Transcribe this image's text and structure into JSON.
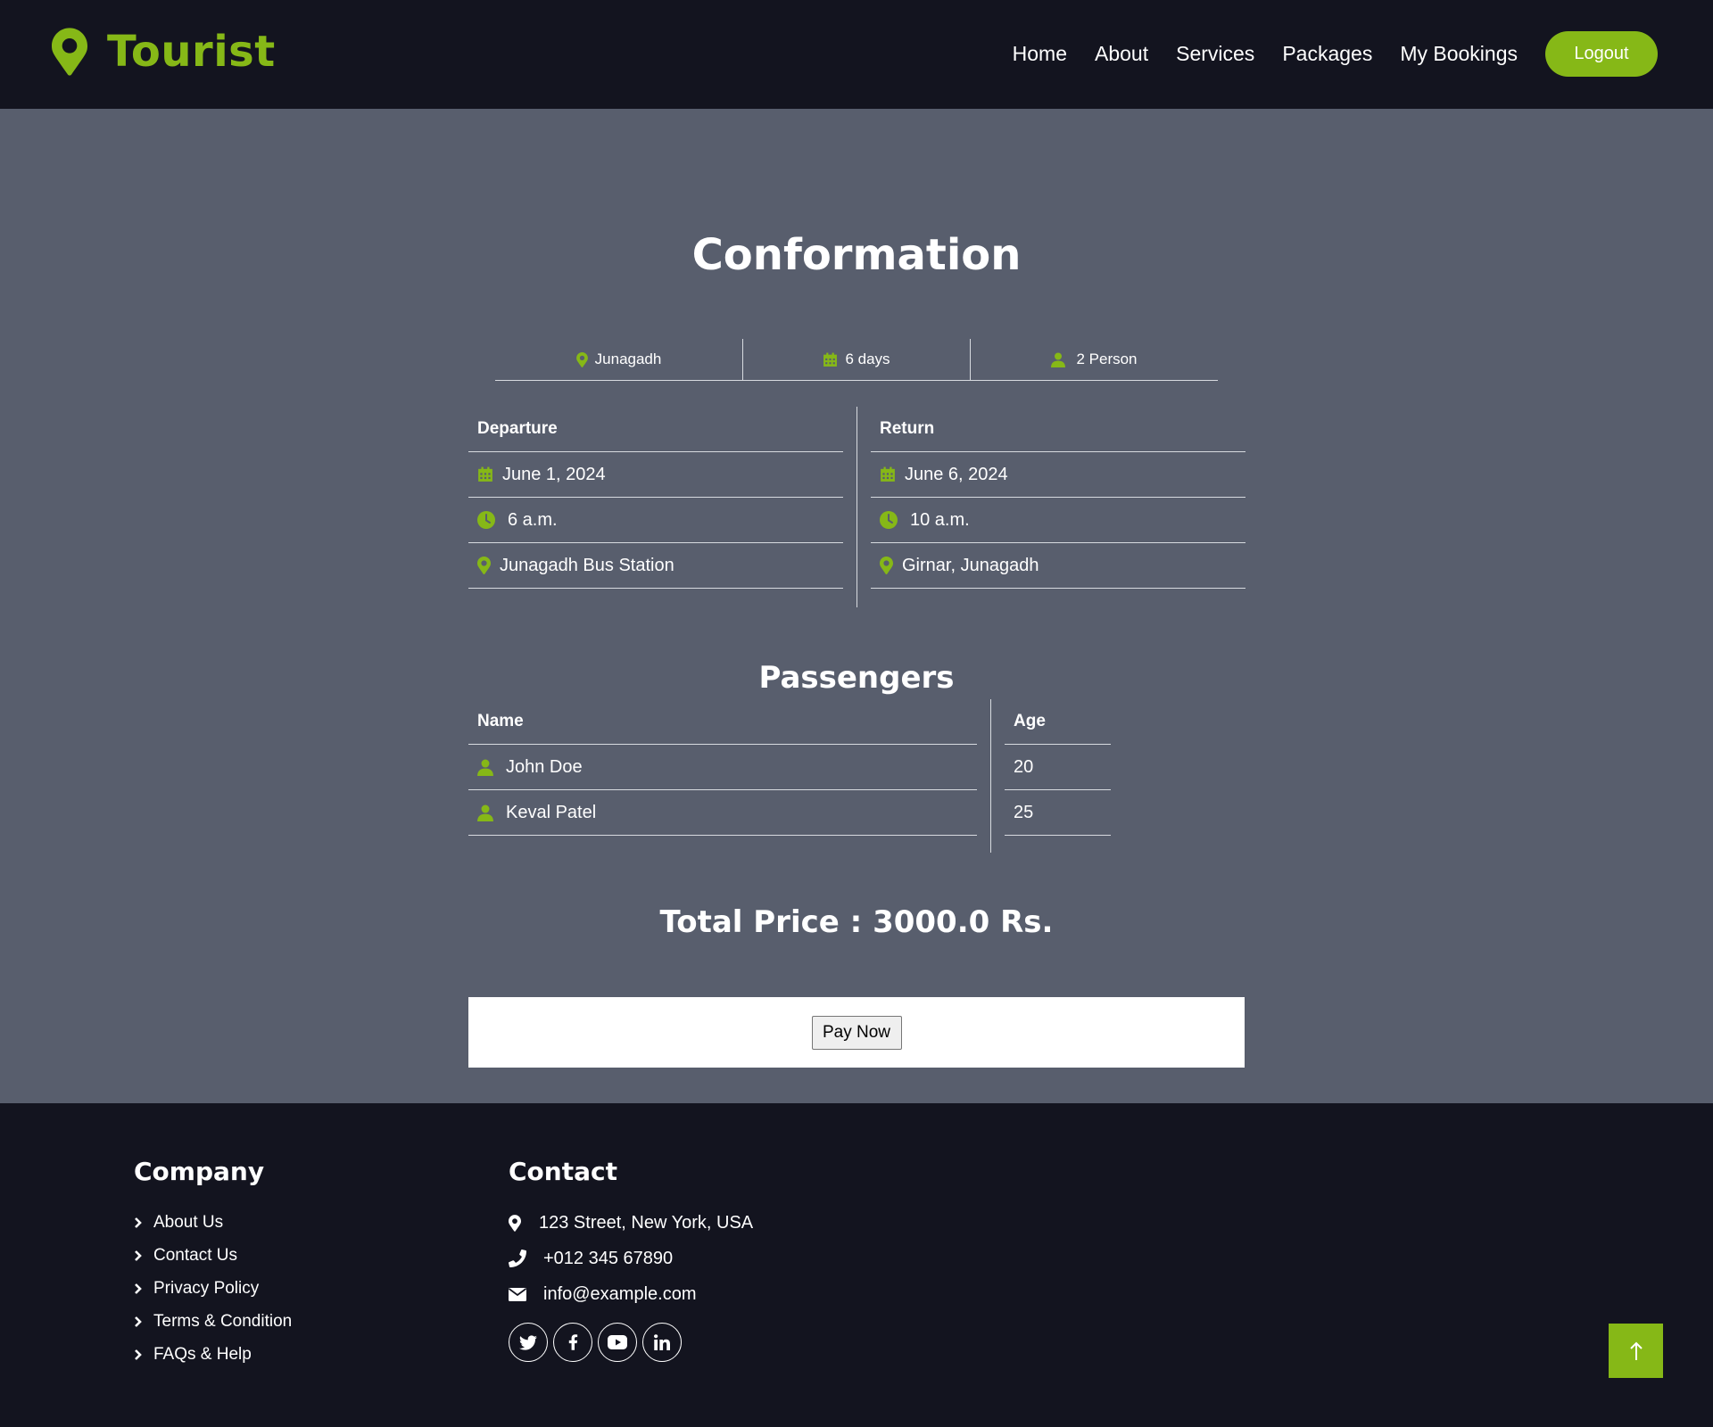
{
  "colors": {
    "accent": "#86b817",
    "nav_bg": "#13141f",
    "main_bg": "#585e6d",
    "text": "#ffffff"
  },
  "brand": {
    "name": "Tourist",
    "icon": "map-marker-icon"
  },
  "nav": {
    "items": [
      {
        "label": "Home"
      },
      {
        "label": "About"
      },
      {
        "label": "Services"
      },
      {
        "label": "Packages"
      },
      {
        "label": "My Bookings"
      }
    ],
    "logout_label": "Logout"
  },
  "main": {
    "title": "Conformation",
    "summary": {
      "destination": "Junagadh",
      "duration": "6 days",
      "persons": "2 Person"
    },
    "departure": {
      "header": "Departure",
      "date": "June 1, 2024",
      "time": "6 a.m.",
      "place": "Junagadh Bus Station"
    },
    "return": {
      "header": "Return",
      "date": "June 6, 2024",
      "time": "10 a.m.",
      "place": "Girnar, Junagadh"
    },
    "passengers": {
      "title": "Passengers",
      "name_header": "Name",
      "age_header": "Age",
      "rows": [
        {
          "name": "John Doe",
          "age": "20"
        },
        {
          "name": "Keval Patel",
          "age": "25"
        }
      ]
    },
    "total_price": "Total Price : 3000.0 Rs.",
    "pay_button": "Pay Now"
  },
  "footer": {
    "company": {
      "title": "Company",
      "links": [
        "About Us",
        "Contact Us",
        "Privacy Policy",
        "Terms & Condition",
        "FAQs & Help"
      ]
    },
    "contact": {
      "title": "Contact",
      "address": "123 Street, New York, USA",
      "phone": "+012 345 67890",
      "email": "info@example.com"
    },
    "socials": [
      "twitter-icon",
      "facebook-icon",
      "youtube-icon",
      "linkedin-icon"
    ],
    "back_to_top_icon": "arrow-up-icon"
  }
}
